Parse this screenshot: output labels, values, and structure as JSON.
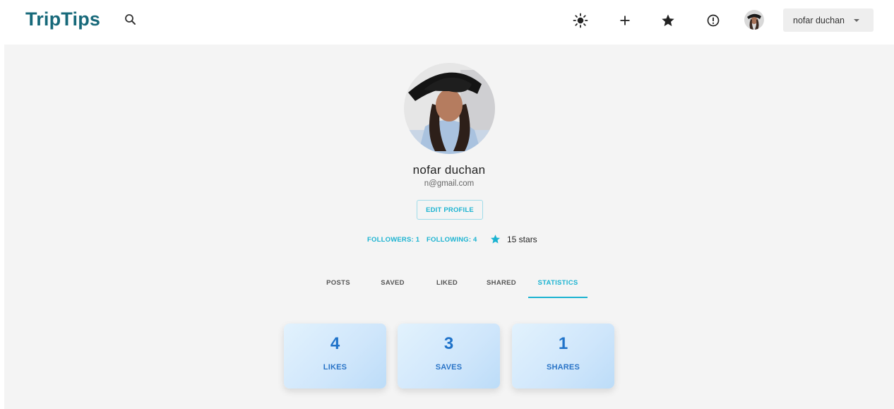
{
  "header": {
    "logo": "TripTips",
    "user_name": "nofar duchan"
  },
  "icons": {
    "search": "search-icon",
    "theme": "sun-icon",
    "add": "plus-icon",
    "favorites": "star-icon",
    "alerts": "exclamation-circle-icon",
    "menu": "chevron-down-icon"
  },
  "profile": {
    "name": "nofar duchan",
    "email": "n@gmail.com",
    "edit_label": "EDIT PROFILE",
    "followers_label": "FOLLOWERS: 1",
    "following_label": "FOLLOWING: 4",
    "stars_label": "15 stars"
  },
  "tabs": [
    {
      "label": "POSTS"
    },
    {
      "label": "SAVED"
    },
    {
      "label": "LIKED"
    },
    {
      "label": "SHARED"
    },
    {
      "label": "STATISTICS",
      "active": true
    }
  ],
  "stats": [
    {
      "value": "4",
      "label": "LIKES"
    },
    {
      "value": "3",
      "label": "SAVES"
    },
    {
      "value": "1",
      "label": "SHARES"
    }
  ],
  "colors": {
    "brand": "#17697a",
    "accent": "#1bb3d1",
    "stat_text": "#1f72c9"
  }
}
